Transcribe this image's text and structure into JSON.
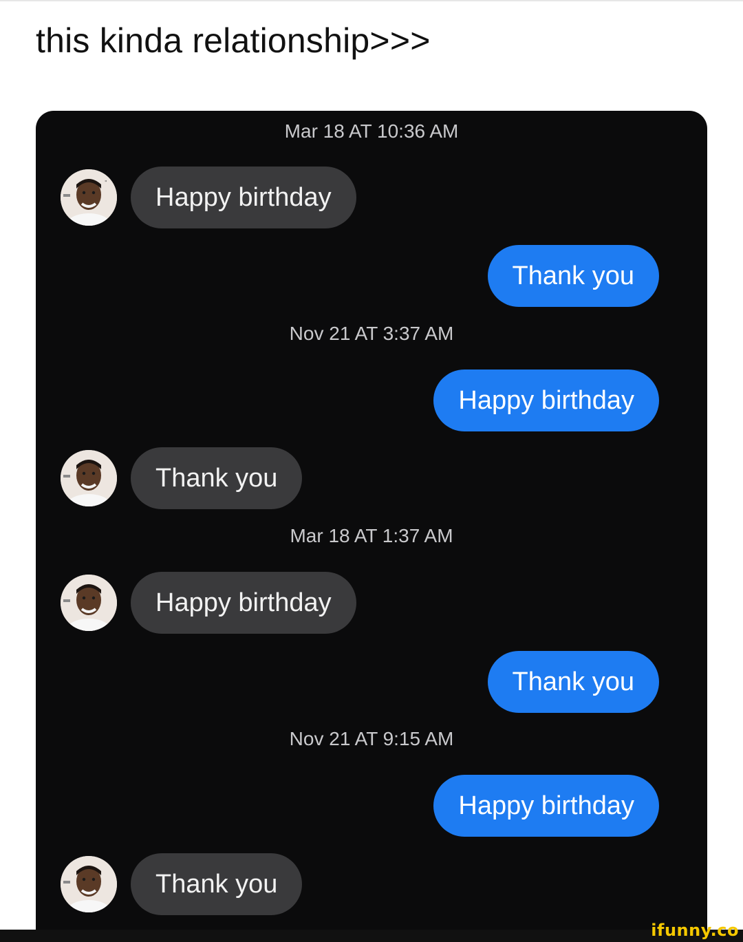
{
  "post": {
    "caption": "this kinda relationship>>>"
  },
  "chat": {
    "colors": {
      "background": "#0b0b0c",
      "incoming_bubble": "#3a3a3c",
      "outgoing_bubble": "#1e7cf2",
      "timestamp_text": "#c9c9cc"
    },
    "timestamps": [
      "Mar 18 AT 10:36 AM",
      "Nov 21 AT 3:37 AM",
      "Mar 18 AT 1:37 AM",
      "Nov 21 AT 9:15 AM"
    ],
    "messages": [
      {
        "direction": "incoming",
        "text": "Happy birthday"
      },
      {
        "direction": "outgoing",
        "text": "Thank you"
      },
      {
        "direction": "outgoing",
        "text": "Happy birthday"
      },
      {
        "direction": "incoming",
        "text": "Thank you"
      },
      {
        "direction": "incoming",
        "text": "Happy birthday"
      },
      {
        "direction": "outgoing",
        "text": "Thank you"
      },
      {
        "direction": "outgoing",
        "text": "Happy birthday"
      },
      {
        "direction": "incoming",
        "text": "Thank you"
      }
    ],
    "avatar_icon": "contact-avatar-icon"
  },
  "watermark": {
    "text": "ifunny.co",
    "color": "#f5c800"
  }
}
